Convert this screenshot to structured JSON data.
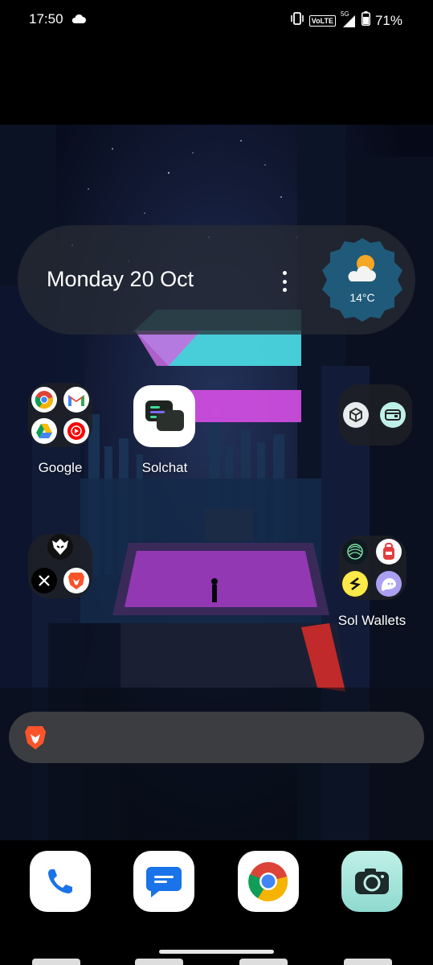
{
  "status_bar": {
    "time": "17:50",
    "network": "VoLTE",
    "signal_type": "5G",
    "battery": "71%",
    "icons": [
      "cloud-icon",
      "vibrate-icon",
      "signal-icon",
      "battery-icon"
    ]
  },
  "date_widget": {
    "date": "Monday 20 Oct"
  },
  "weather_widget": {
    "temperature": "14°C",
    "icon": "partly-cloudy-icon"
  },
  "home": {
    "google_folder": {
      "label": "Google",
      "apps": [
        "chrome-icon",
        "gmail-icon",
        "drive-icon",
        "youtube-music-icon"
      ]
    },
    "solchat": {
      "label": "Solchat"
    },
    "unnamed_folder_1": {
      "apps": [
        "cube-icon",
        "wallet-card-icon"
      ]
    },
    "social_folder": {
      "apps": [
        "eagle-icon",
        "x-icon",
        "brave-icon"
      ]
    },
    "sol_wallets": {
      "label": "Sol Wallets",
      "apps": [
        "wave-icon",
        "backpack-icon",
        "solflare-icon",
        "phantom-icon"
      ]
    }
  },
  "search_bar": {
    "icon": "brave-lion-icon"
  },
  "dock": {
    "apps": [
      "phone-icon",
      "messages-icon",
      "chrome-icon",
      "camera-icon"
    ]
  },
  "colors": {
    "accent_purple": "#d64fe6",
    "accent_cyan": "#4de0e8",
    "widget_blue": "#1f5a7a"
  }
}
